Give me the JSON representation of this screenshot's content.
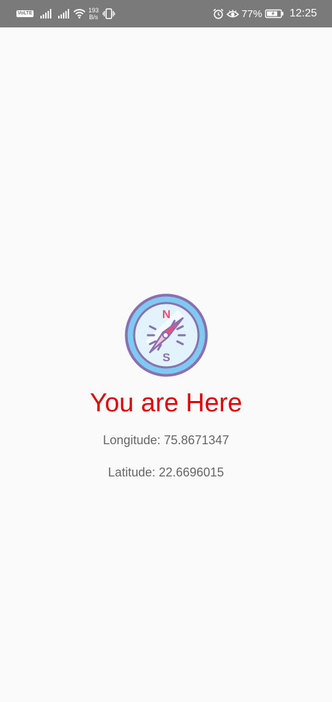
{
  "status_bar": {
    "volte": "VoLTE",
    "net_speed_value": "193",
    "net_speed_unit": "B/s",
    "battery_percent": "77%",
    "time": "12:25",
    "icons": [
      "volte-icon",
      "signal-icon",
      "signal-icon",
      "wifi-icon",
      "vibrate-icon",
      "alarm-icon",
      "eye-comfort-icon",
      "battery-icon"
    ]
  },
  "location": {
    "heading": "You are Here",
    "longitude_text": "Longitude: 75.8671347",
    "latitude_text": "Latitude: 22.6696015",
    "compass_north": "N",
    "compass_south": "S"
  },
  "colors": {
    "status_bar_bg": "#7a7a7a",
    "background": "#fafafa",
    "heading": "#e00000",
    "coord_text": "#666666"
  }
}
